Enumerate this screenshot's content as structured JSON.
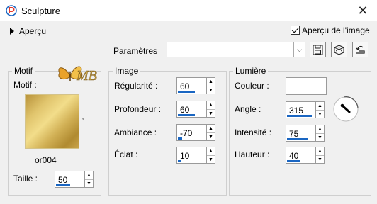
{
  "window": {
    "title": "Sculpture",
    "close_glyph": "✕"
  },
  "preview": {
    "toggle_label": "Aperçu",
    "checkbox_label": "Aperçu de l'image",
    "checked": true
  },
  "parametres": {
    "label": "Paramètres",
    "value": ""
  },
  "motif": {
    "group_title": "Motif",
    "field_label": "Motif :",
    "pattern_name": "or004",
    "taille_label": "Taille :",
    "taille_value": "50",
    "taille_level": 0.5
  },
  "image": {
    "group_title": "Image",
    "fields": [
      {
        "label": "Régularité :",
        "value": "60",
        "level": 0.6
      },
      {
        "label": "Profondeur :",
        "value": "60",
        "level": 0.6
      },
      {
        "label": "Ambiance :",
        "value": "-70",
        "level": 0.15
      },
      {
        "label": "Éclat :",
        "value": "10",
        "level": 0.1
      }
    ]
  },
  "lumiere": {
    "group_title": "Lumière",
    "couleur_label": "Couleur :",
    "couleur_value": "#ffffff",
    "fields": [
      {
        "label": "Angle :",
        "value": "315",
        "level": 0.875
      },
      {
        "label": "Intensité :",
        "value": "75",
        "level": 0.75
      },
      {
        "label": "Hauteur :",
        "value": "40",
        "level": 0.45
      }
    ]
  },
  "logo_text": "MB",
  "colors": {
    "accent": "#1a66c2",
    "gold": "#d4b35a"
  },
  "icons": [
    "app-icon",
    "close-icon",
    "expand-arrow-icon",
    "checkbox-icon",
    "dropdown-arrow-icon",
    "save-preset-icon",
    "randomize-icon",
    "reset-icon",
    "spin-up-icon",
    "spin-down-icon",
    "angle-dial-icon"
  ]
}
